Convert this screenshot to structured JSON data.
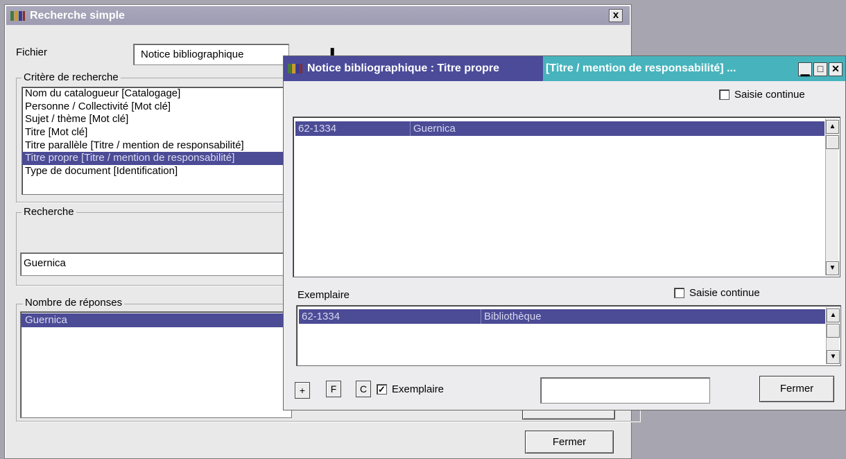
{
  "back_window": {
    "title": "Recherche simple",
    "close_glyph": "x",
    "fichier_label": "Fichier",
    "fichier_value": "Notice bibliographique",
    "criteres_title": "Critère de recherche",
    "criteres": [
      "Nom du catalogueur [Catalogage]",
      "Personne / Collectivité [Mot clé]",
      "Sujet / thème [Mot clé]",
      "Titre [Mot clé]",
      "Titre parallèle [Titre / mention de responsabilité]",
      "Titre propre [Titre / mention de responsabilité]",
      "Type de document [Identification]"
    ],
    "selected_critere_index": 5,
    "recherche_title": "Recherche",
    "recherche_value": "Guernica",
    "reponses_title": "Nombre de réponses",
    "reponses": [
      "Guernica"
    ],
    "fermer_label": "Fermer"
  },
  "front_window": {
    "title_part1": "Notice bibliographique : Titre propre",
    "title_part2": "[Titre / mention de responsabilité] ...",
    "saisie_continue_1": "Saisie continue",
    "notice_row": {
      "code": "62-1334",
      "titre": "Guernica"
    },
    "exemplaire_label": "Exemplaire",
    "saisie_continue_2": "Saisie continue",
    "exemplaire_row": {
      "code": "62-1334",
      "lieu": "Bibliothèque"
    },
    "btn_plus": "+",
    "btn_f": "F",
    "btn_c": "C",
    "exemplaire_checkbox_label": "Exemplaire",
    "exemplaire_checked": true,
    "fermer_label": "Fermer"
  },
  "colors": {
    "selection": "#4b4b96",
    "front_title_active": "#4b4b9a",
    "front_title_accent": "#47b4bd",
    "back_title": "#a9a7ba"
  }
}
